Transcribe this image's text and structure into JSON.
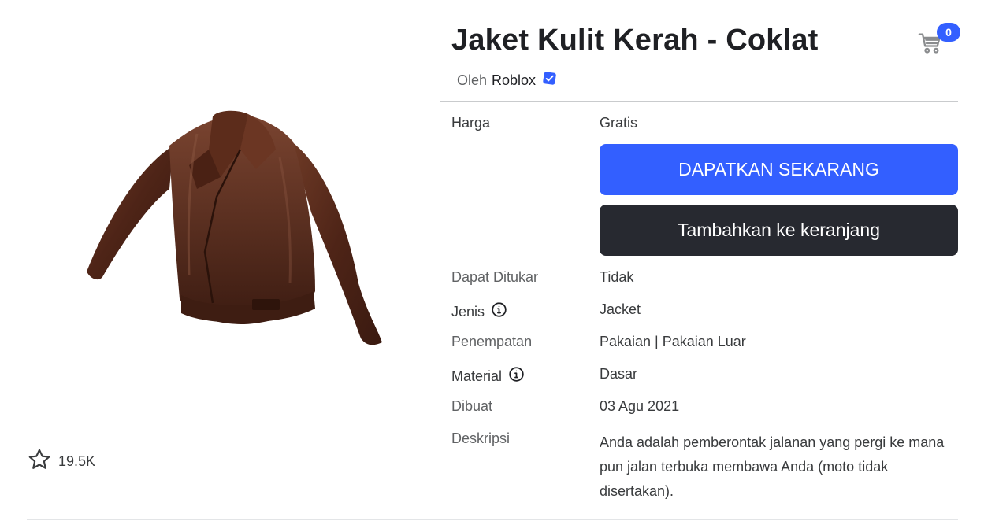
{
  "item": {
    "title": "Jaket Kulit Kerah - Coklat",
    "by_prefix": "Oleh",
    "creator": "Roblox",
    "favorites": "19.5K"
  },
  "cart": {
    "count": "0"
  },
  "details": {
    "price_label": "Harga",
    "price_value": "Gratis",
    "buy_button": "DAPATKAN SEKARANG",
    "add_to_cart_button": "Tambahkan ke keranjang",
    "tradable_label": "Dapat Ditukar",
    "tradable_value": "Tidak",
    "type_label": "Jenis",
    "type_value": "Jacket",
    "placement_label": "Penempatan",
    "placement_value": "Pakaian | Pakaian Luar",
    "material_label": "Material",
    "material_value": "Dasar",
    "created_label": "Dibuat",
    "created_value": "03 Agu 2021",
    "description_label": "Deskripsi",
    "description_value": "Anda adalah pemberontak jalanan yang pergi ke mana pun jalan terbuka membawa Anda (moto tidak disertakan)."
  },
  "colors": {
    "primary_button": "#335fff",
    "secondary_button": "#272930",
    "verified_badge": "#335fff",
    "jacket": "#5a2b1c"
  },
  "icons": [
    "star-icon",
    "cart-icon",
    "verified-badge-icon",
    "info-icon"
  ]
}
